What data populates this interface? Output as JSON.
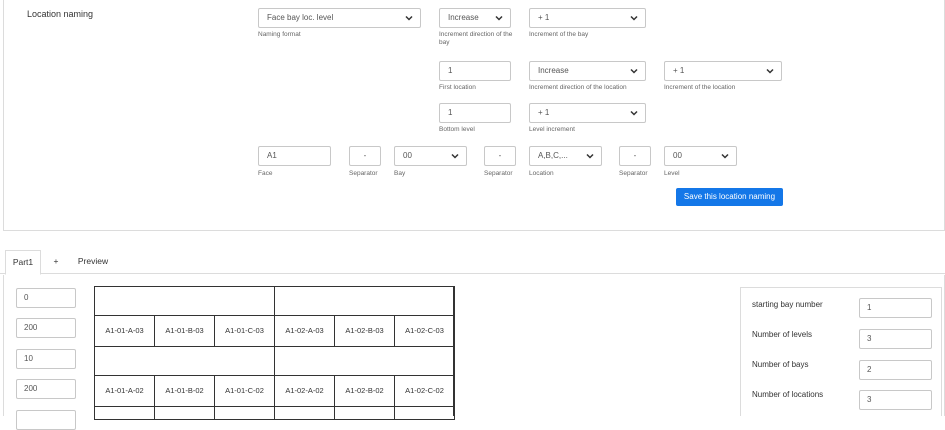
{
  "location_naming": {
    "section_label": "Location naming",
    "naming_format": {
      "value": "Face bay loc. level",
      "hint": "Naming format"
    },
    "bay_direction": {
      "value": "Increase",
      "hint": "Increment direction of the bay"
    },
    "bay_increment": {
      "value": "+ 1",
      "hint": "Increment of the bay"
    },
    "first_location": {
      "value": "1",
      "hint": "First location"
    },
    "location_direction": {
      "value": "Increase",
      "hint": "Increment direction of the location"
    },
    "location_increment": {
      "value": "+ 1",
      "hint": "Increment of the location"
    },
    "bottom_level": {
      "value": "1",
      "hint": "Bottom level"
    },
    "level_increment": {
      "value": "+ 1",
      "hint": "Level increment"
    },
    "face": {
      "value": "A1",
      "hint": "Face"
    },
    "separator1": {
      "value": "-",
      "hint": "Separator"
    },
    "bay": {
      "value": "00",
      "hint": "Bay"
    },
    "separator2": {
      "value": "-",
      "hint": "Separator"
    },
    "location": {
      "value": "A,B,C,...",
      "hint": "Location"
    },
    "separator3": {
      "value": "-",
      "hint": "Separator"
    },
    "level": {
      "value": "00",
      "hint": "Level"
    },
    "save_button": "Save this location naming"
  },
  "tabs": [
    {
      "label": "Part1"
    },
    {
      "label": "+"
    },
    {
      "label": "Preview"
    }
  ],
  "left_inputs": [
    "0",
    "200",
    "10",
    "200"
  ],
  "grid": {
    "row_top": [
      "A1-01-A-03",
      "A1-01-B-03",
      "A1-01-C-03",
      "A1-02-A-03",
      "A1-02-B-03",
      "A1-02-C-03"
    ],
    "row_bottom": [
      "A1-01-A-02",
      "A1-01-B-02",
      "A1-01-C-02",
      "A1-02-A-02",
      "A1-02-B-02",
      "A1-02-C-02"
    ]
  },
  "properties": {
    "starting_bay_number": {
      "label": "starting bay number",
      "value": "1"
    },
    "number_of_levels": {
      "label": "Number of levels",
      "value": "3"
    },
    "number_of_bays": {
      "label": "Number of bays",
      "value": "2"
    },
    "number_of_locations": {
      "label": "Number of locations",
      "value": "3"
    }
  },
  "colors": {
    "accent": "#1477e8",
    "border": "#c8c8c8"
  },
  "icons": {
    "select": "chevron-down-icon"
  }
}
